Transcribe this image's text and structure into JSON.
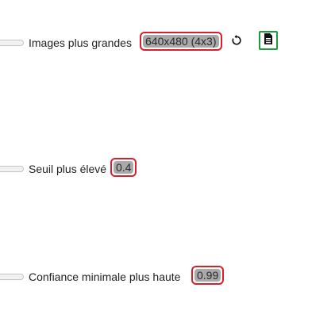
{
  "settings": [
    {
      "label": "Images plus grandes",
      "value": "640x480 (4x3)",
      "icons": [
        "slider-track",
        "reset-icon",
        "document-icon"
      ]
    },
    {
      "label": "Seuil plus élevé",
      "value": "0.4"
    },
    {
      "label": "Confiance minimale plus haute",
      "value": "0.99"
    }
  ],
  "colors": {
    "highlight_red": "#d9202a",
    "highlight_green": "#1f9a3e",
    "badge_gray": "#a9a9a9"
  }
}
